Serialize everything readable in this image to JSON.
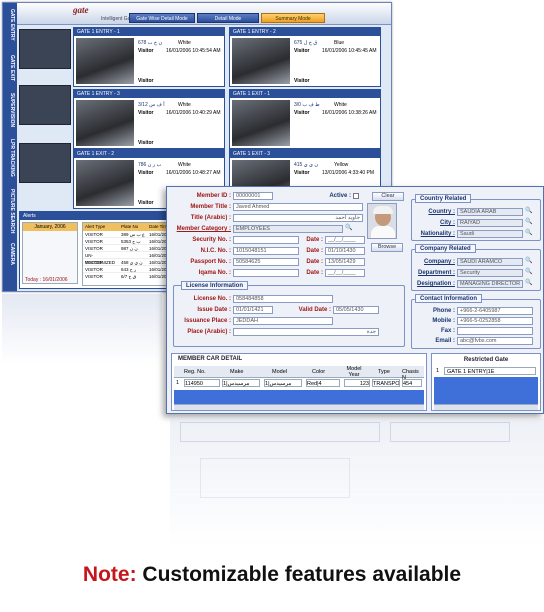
{
  "back": {
    "logo": "gate",
    "logo_sub": "Intelligent Gate",
    "tabs": [
      "Gate Wise Detail Mode",
      "Detail Mode",
      "Summary Mode"
    ],
    "side_labels": [
      "GATE ENTRY",
      "GATE EXIT",
      "SUPERVISION",
      "LPR TRACKING",
      "PICTURE SEARCH",
      "CAMERA"
    ],
    "cards": [
      {
        "title": "GATE 1 ENTRY - 1",
        "plate": "ن ح ب 678",
        "color": "White",
        "type": "Visitor",
        "date": "16/01/2006 10:45:54 AM"
      },
      {
        "title": "GATE 1 ENTRY - 2",
        "plate": "ق ح ل 675",
        "color": "Blue",
        "type": "Visitor",
        "date": "16/01/2006 10:45:45 AM"
      },
      {
        "title": "GATE 1 ENTRY - 3",
        "plate": "أ ف س 3/12",
        "color": "White",
        "type": "Visitor",
        "date": "16/01/2006 10:40:29 AM"
      },
      {
        "title": "GATE 1 EXIT - 1",
        "plate": "ط ف ب 3/0",
        "color": "White",
        "type": "Visitor",
        "date": "16/01/2006 10:38:26 AM"
      },
      {
        "title": "GATE 1 EXIT - 2",
        "plate": "ب ر ن 786",
        "color": "White",
        "type": "Visitor",
        "date": "16/01/2006 10:48:27 AM"
      },
      {
        "title": "GATE 1 EXIT - 3",
        "plate": "ن ي ي 415",
        "color": "Yellow",
        "type": "Visitor",
        "date": "13/01/2006 4:33:40 PM"
      }
    ],
    "card_badge": "MAPS",
    "alerts_title": "Alerts",
    "calendar_month": "January, 2006",
    "today": "Today : 16/01/2006",
    "alert_headers": [
      "Alert Type",
      "Plate No",
      "Date Time"
    ],
    "alert_rows": [
      [
        "VISITOR",
        "ع ب س 389",
        "16/01/2006"
      ],
      [
        "VISITOR",
        "ب ح 5353",
        "16/01/2006"
      ],
      [
        "VISITOR",
        "ن ن 987",
        "16/01/2006"
      ],
      [
        "UN-RECOGNIZED",
        "",
        "16/01/2006"
      ],
      [
        "VISITOR",
        "ن ي ي 458",
        "16/01/2006"
      ],
      [
        "VISITOR",
        "ر ح 643",
        "16/01/2006"
      ],
      [
        "VISITOR",
        "ق ح 6/7",
        "16/01/2006"
      ]
    ]
  },
  "form": {
    "member_id_label": "Member ID :",
    "member_id": "00000001",
    "active_label": "Active :",
    "clear_label": "Clear",
    "member_title_label": "Member Title :",
    "member_title": "Javed Ahmed",
    "title_arabic_label": "Title (Arabic) :",
    "title_arabic": "جاويد أحمد",
    "member_category_label": "Member Category :",
    "member_category": "EMPLOYEES",
    "security_no_label": "Security No. :",
    "nic_label": "N.I.C. No. :",
    "nic": "1015048151",
    "passport_label": "Passport No. :",
    "passport": "50584625",
    "iqama_label": "Iqama No. :",
    "date_label": "Date :",
    "date_blank": "__/__/____",
    "nic_date": "01/10/1430",
    "passport_date": "13/05/1429",
    "browse_label": "Browse",
    "license_title": "License Information",
    "license_no_label": "License No. :",
    "license_no": "058484858",
    "issue_date_label": "Issue Date :",
    "issue_date": "01/01/1421",
    "valid_date_label": "Valid Date :",
    "valid_date": "05/05/1430",
    "issuance_place_label": "Issuance Place :",
    "issuance_place": "JEDDAH",
    "place_arabic_label": "Place (Arabic) :",
    "place_arabic": "جدة",
    "country_title": "Country Related",
    "country_label": "Country :",
    "country": "SAUDIA ARAB",
    "city_label": "City :",
    "city": "RAIYAD",
    "nationality_label": "Nationality :",
    "nationality": "Saudi",
    "company_title": "Company Related",
    "company_label": "Company :",
    "company": "SAUDI ARAMCO",
    "department_label": "Department :",
    "department": "Security",
    "designation_label": "Designation :",
    "designation": "MANAGING DIRECTOR",
    "contact_title": "Contact Information",
    "phone_label": "Phone :",
    "phone": "+966-2-6405987",
    "mobile_label": "Mobile :",
    "mobile": "+966-5-0252858",
    "fax_label": "Fax :",
    "email_label": "Email :",
    "email": "abc@fvbs.com",
    "car_title": "MEMBER CAR DETAIL",
    "car_headers": [
      "Reg. No.",
      "Make",
      "Model",
      "Color",
      "Model Year",
      "Type",
      "Chasis N"
    ],
    "car_row": {
      "index": "1",
      "reg": "114950",
      "make": "مرسيدس|1",
      "model": "مرسيدس|1",
      "color": "Red|4",
      "year": "123",
      "type": "TRANSPOR",
      "chasis": "454"
    },
    "gate_title": "Restricted Gate",
    "gate_row": {
      "index": "1",
      "gate": "GATE 1 ENTRY|1E"
    }
  },
  "note": {
    "prefix": "Note:",
    "text": " Customizable features available"
  },
  "colors": {
    "note_prefix": "#c4161c",
    "accent": "#2c4f9a",
    "label": "#a01818"
  }
}
